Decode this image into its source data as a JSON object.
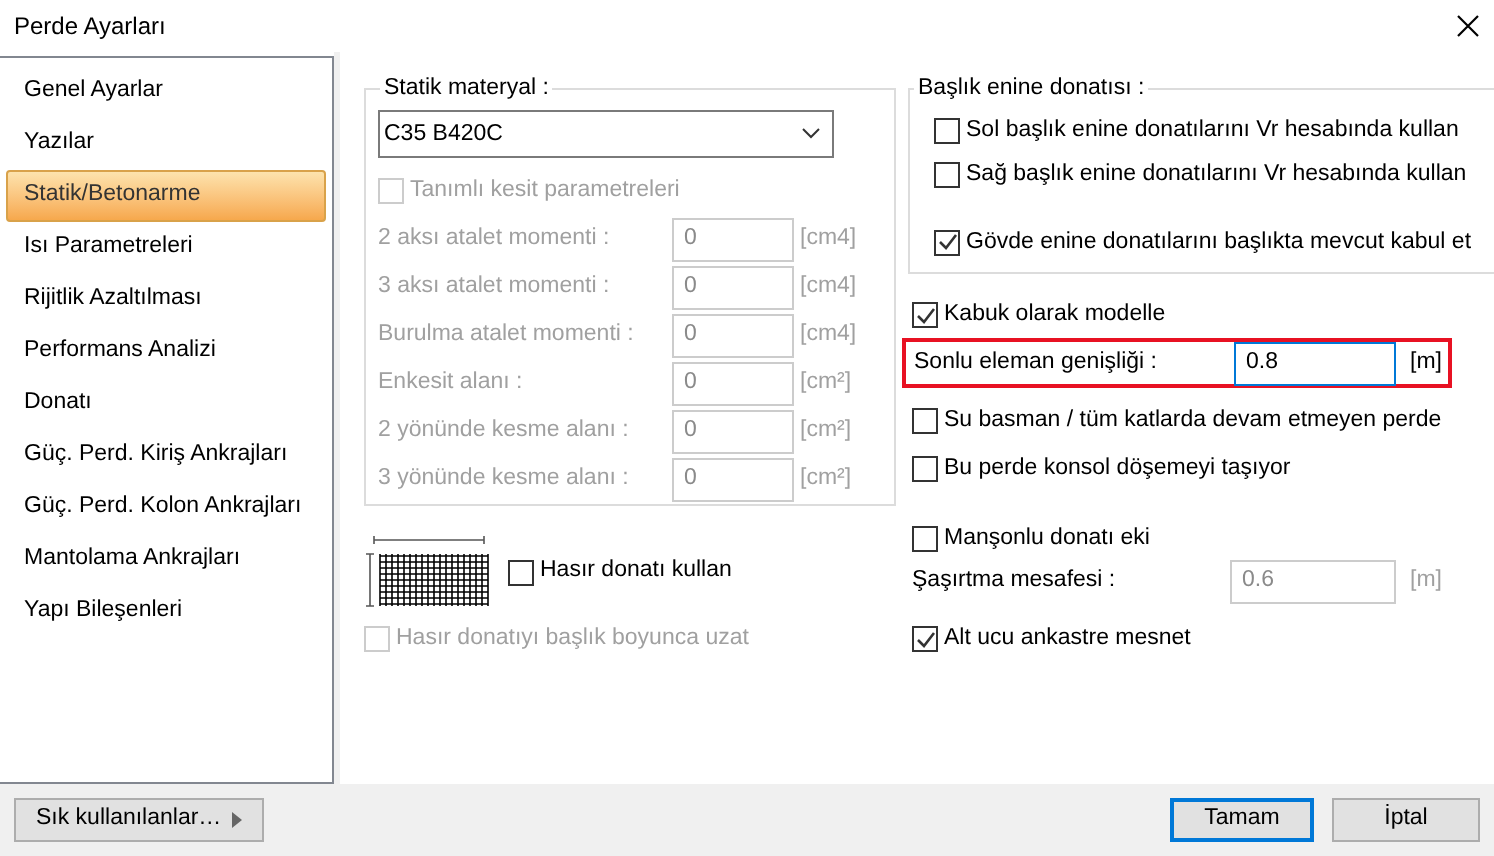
{
  "window": {
    "title": "Perde Ayarları"
  },
  "sidebar": {
    "items": [
      {
        "label": "Genel Ayarlar",
        "selected": false
      },
      {
        "label": "Yazılar",
        "selected": false
      },
      {
        "label": "Statik/Betonarme",
        "selected": true
      },
      {
        "label": "Isı Parametreleri",
        "selected": false
      },
      {
        "label": "Rijitlik Azaltılması",
        "selected": false
      },
      {
        "label": "Performans Analizi",
        "selected": false
      },
      {
        "label": "Donatı",
        "selected": false
      },
      {
        "label": "Güç. Perd. Kiriş Ankrajları",
        "selected": false
      },
      {
        "label": "Güç. Perd. Kolon Ankrajları",
        "selected": false
      },
      {
        "label": "Mantolama Ankrajları",
        "selected": false
      },
      {
        "label": "Yapı Bileşenleri",
        "selected": false
      }
    ]
  },
  "material": {
    "legend": "Statik materyal :",
    "value": "C35 B420C",
    "custom_section": {
      "label": "Tanımlı kesit parametreleri",
      "checked": false,
      "disabled": true
    },
    "params": [
      {
        "label": "2 aksı atalet momenti :",
        "value": "0",
        "unit": "[cm4]",
        "disabled": true
      },
      {
        "label": "3 aksı atalet momenti :",
        "value": "0",
        "unit": "[cm4]",
        "disabled": true
      },
      {
        "label": "Burulma atalet momenti :",
        "value": "0",
        "unit": "[cm4]",
        "disabled": true
      },
      {
        "label": "Enkesit alanı :",
        "value": "0",
        "unit": "[cm²]",
        "disabled": true
      },
      {
        "label": "2 yönünde kesme alanı :",
        "value": "0",
        "unit": "[cm²]",
        "disabled": true
      },
      {
        "label": "3 yönünde kesme alanı :",
        "value": "0",
        "unit": "[cm²]",
        "disabled": true
      }
    ]
  },
  "mesh": {
    "use": {
      "label": "Hasır donatı kullan",
      "checked": false,
      "disabled": false
    },
    "extend": {
      "label": "Hasır donatıyı başlık boyunca uzat",
      "checked": false,
      "disabled": true
    }
  },
  "head_rebar": {
    "legend": "Başlık enine donatısı :",
    "options": [
      {
        "label": "Sol başlık enine donatılarını Vr hesabında kullan",
        "checked": false
      },
      {
        "label": "Sağ başlık enine donatılarını Vr hesabında kullan",
        "checked": false
      },
      {
        "label": "Gövde enine donatılarını başlıkta mevcut kabul et",
        "checked": true
      }
    ]
  },
  "shell": {
    "label": "Kabuk olarak modelle",
    "checked": true
  },
  "element_width": {
    "label": "Sonlu eleman genişliği :",
    "value": "0.8",
    "unit": "[m]",
    "disabled": false,
    "highlighted": true
  },
  "options": [
    {
      "label": "Su basman / tüm katlarda devam etmeyen perde",
      "checked": false
    },
    {
      "label": "Bu perde konsol döşemeyi taşıyor",
      "checked": false
    }
  ],
  "coupler": {
    "label": "Manşonlu donatı eki",
    "checked": false
  },
  "offset": {
    "label": "Şaşırtma mesafesi :",
    "value": "0.6",
    "unit": "[m]",
    "disabled": true
  },
  "fixed_base": {
    "label": "Alt ucu ankastre mesnet",
    "checked": true
  },
  "footer": {
    "favorites": "Sık kullanılanlar…",
    "ok": "Tamam",
    "cancel": "İptal"
  }
}
